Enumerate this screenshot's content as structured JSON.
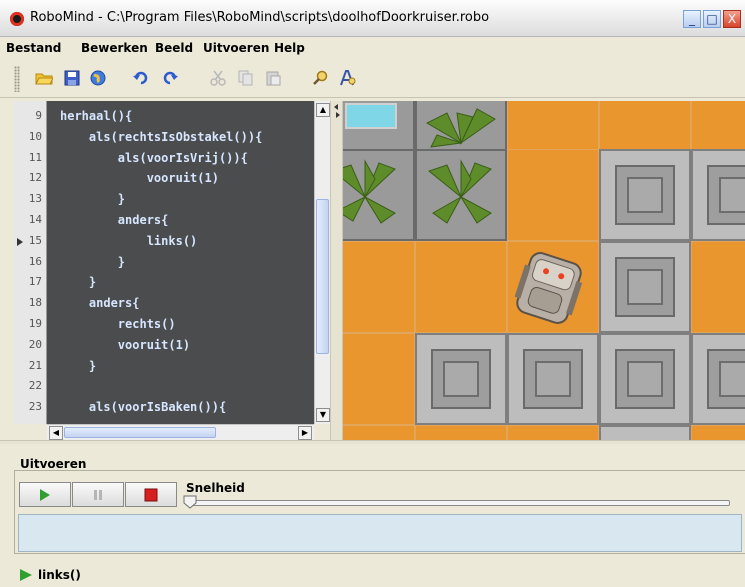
{
  "window": {
    "title": "RoboMind - C:\\Program Files\\RoboMind\\scripts\\doolhofDoorkruiser.robo",
    "minimize": "_",
    "maximize": "□",
    "close": "X"
  },
  "menu": {
    "items": [
      "Bestand",
      "Bewerken",
      "Beeld",
      "Uitvoeren",
      "Help"
    ]
  },
  "toolbar": {
    "icons": [
      "open-folder-icon",
      "save-icon",
      "globe-icon",
      "undo-icon",
      "redo-icon",
      "cut-icon",
      "copy-icon",
      "paste-icon",
      "find-icon",
      "replace-icon"
    ]
  },
  "editor": {
    "current_line": "15",
    "lines": [
      {
        "num": "9",
        "code": "herhaal(){"
      },
      {
        "num": "10",
        "code": "    als(rechtsIsObstakel()){"
      },
      {
        "num": "11",
        "code": "        als(voorIsVrij()){"
      },
      {
        "num": "12",
        "code": "            vooruit(1)"
      },
      {
        "num": "13",
        "code": "        }"
      },
      {
        "num": "14",
        "code": "        anders{"
      },
      {
        "num": "15",
        "code": "            links()"
      },
      {
        "num": "16",
        "code": "        }"
      },
      {
        "num": "17",
        "code": "    }"
      },
      {
        "num": "18",
        "code": "    anders{"
      },
      {
        "num": "19",
        "code": "        rechts()"
      },
      {
        "num": "20",
        "code": "        vooruit(1)"
      },
      {
        "num": "21",
        "code": "    }"
      },
      {
        "num": "22",
        "code": ""
      },
      {
        "num": "23",
        "code": "    als(voorIsBaken()){"
      }
    ]
  },
  "run_panel": {
    "title": "Uitvoeren",
    "speed_label": "Snelheid",
    "speed_value": 0.0,
    "status_text": "links()"
  },
  "colors": {
    "editor_bg": "#4a4c4e",
    "code_text": "#d7e6ff",
    "floor": "#e8962d",
    "output_bg": "#d9e7f1"
  }
}
